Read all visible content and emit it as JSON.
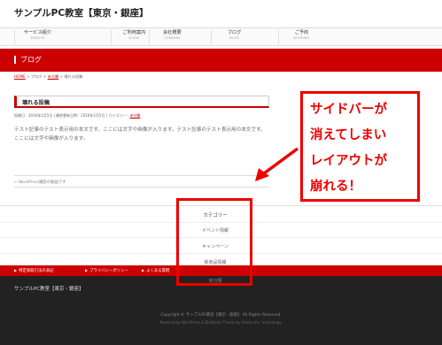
{
  "site": {
    "title": "サンプルPC教室【東京・銀座】"
  },
  "nav": [
    {
      "jp": "サービス紹介",
      "en": "SERVICE"
    },
    {
      "jp": "ご利用案内",
      "en": "GUIDE"
    },
    {
      "jp": "会社概要",
      "en": "COMPANY"
    },
    {
      "jp": "ブログ",
      "en": "BLOG"
    },
    {
      "jp": "ご予約",
      "en": "BOOKING"
    }
  ],
  "page": {
    "heading": "ブログ"
  },
  "breadcrumb": {
    "home": "HOME",
    "sep1": " > ブログ > ",
    "category": "未分類",
    "sep2": " > ",
    "current": "壊れる投稿"
  },
  "post": {
    "title": "壊れる投稿",
    "meta_prefix": "投稿日：2016年1月5日 | 最終更新日時：2016年1月5日 | カテゴリー：",
    "meta_category": "未分類",
    "body": "テスト記事のテスト表示用の本文です。ここには文字や画像が入ります。テスト記事のテスト表示用の本文です。ここには文字や画像が入ります。",
    "prev_link": "← WordPress講座の動画です"
  },
  "sidebar": {
    "title": "カテゴリー",
    "items": [
      "イベント情報",
      "キャンペーン",
      "新商品情報",
      "未分類"
    ]
  },
  "red_links": [
    "特定商取引法の表記",
    "プライバシーポリシー",
    "よくある質問"
  ],
  "footer": {
    "name": "サンプルPC教室【東京・銀座】",
    "copyright": "Copyright © サンプルPC教室【東京・銀座】 All Rights Reserved.",
    "powered": "Powered by WordPress & BizVektor Theme by Vektor,Inc. technology."
  },
  "annotation": {
    "lines": [
      "サイドバーが",
      "消えてしまい",
      "レイアウトが",
      "崩れる！"
    ],
    "color": "#e00000"
  },
  "colors": {
    "accent": "#cc0000",
    "footer": "#222222"
  }
}
